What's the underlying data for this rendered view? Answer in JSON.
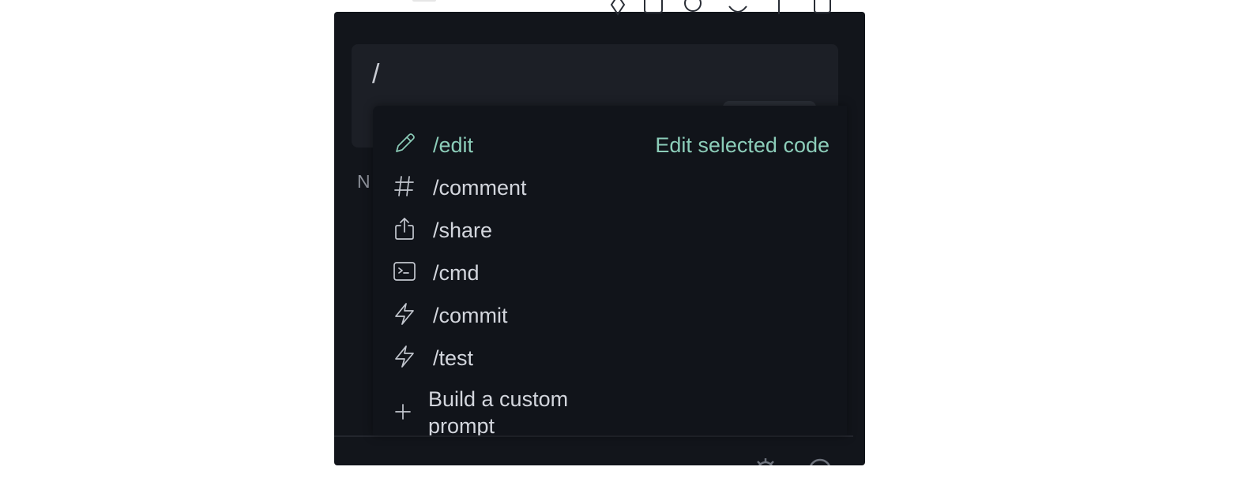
{
  "input": {
    "value": "/"
  },
  "sidebar": {
    "letter": "N"
  },
  "slash_menu": {
    "items": [
      {
        "command": "/edit",
        "description": "Edit selected code",
        "icon": "pencil-icon",
        "active": true
      },
      {
        "command": "/comment",
        "icon": "hash-icon"
      },
      {
        "command": "/share",
        "icon": "share-icon"
      },
      {
        "command": "/cmd",
        "icon": "terminal-icon"
      },
      {
        "command": "/commit",
        "icon": "lightning-icon"
      },
      {
        "command": "/test",
        "icon": "lightning-icon"
      }
    ],
    "custom": {
      "label": "Build a custom prompt",
      "icon": "plus-icon"
    }
  },
  "colors": {
    "panel_bg": "#12151b",
    "input_bg": "#1c1f26",
    "menu_bg": "#11141a",
    "accent": "#8ccdb9",
    "text": "#d3d6dd"
  }
}
